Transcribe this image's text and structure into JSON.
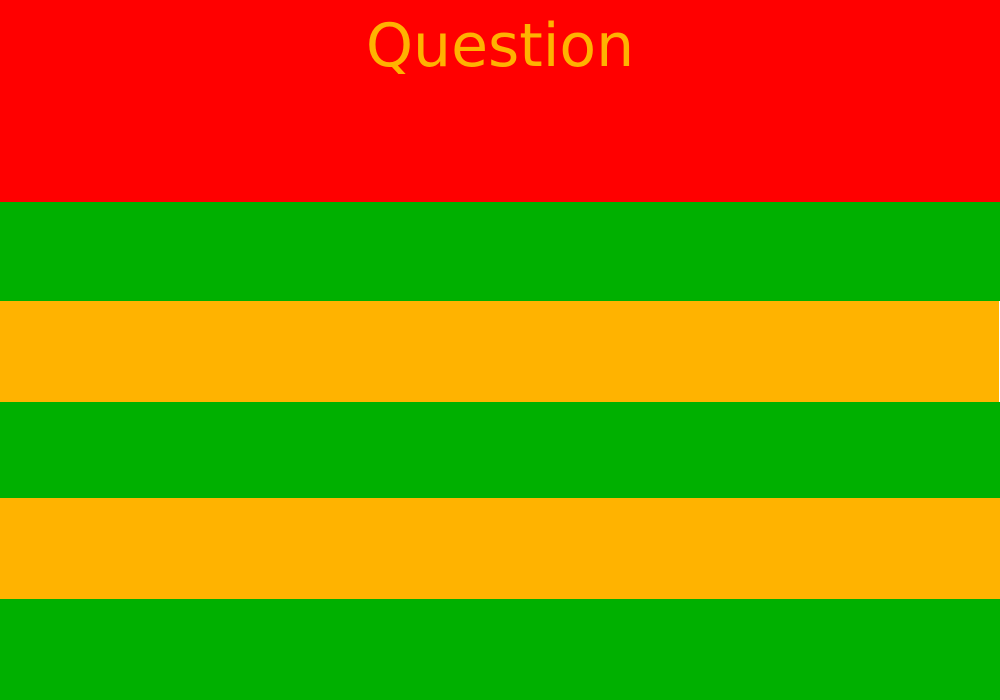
{
  "question": {
    "text": "Question",
    "background": "#ff0000",
    "text_color": "#ffb300"
  },
  "answers": [
    {
      "label": "",
      "background": "#00b000"
    },
    {
      "label": "",
      "background": "#ffb300"
    },
    {
      "label": "",
      "background": "#00b000"
    },
    {
      "label": "",
      "background": "#ffb300"
    },
    {
      "label": "",
      "background": "#00b000"
    }
  ]
}
